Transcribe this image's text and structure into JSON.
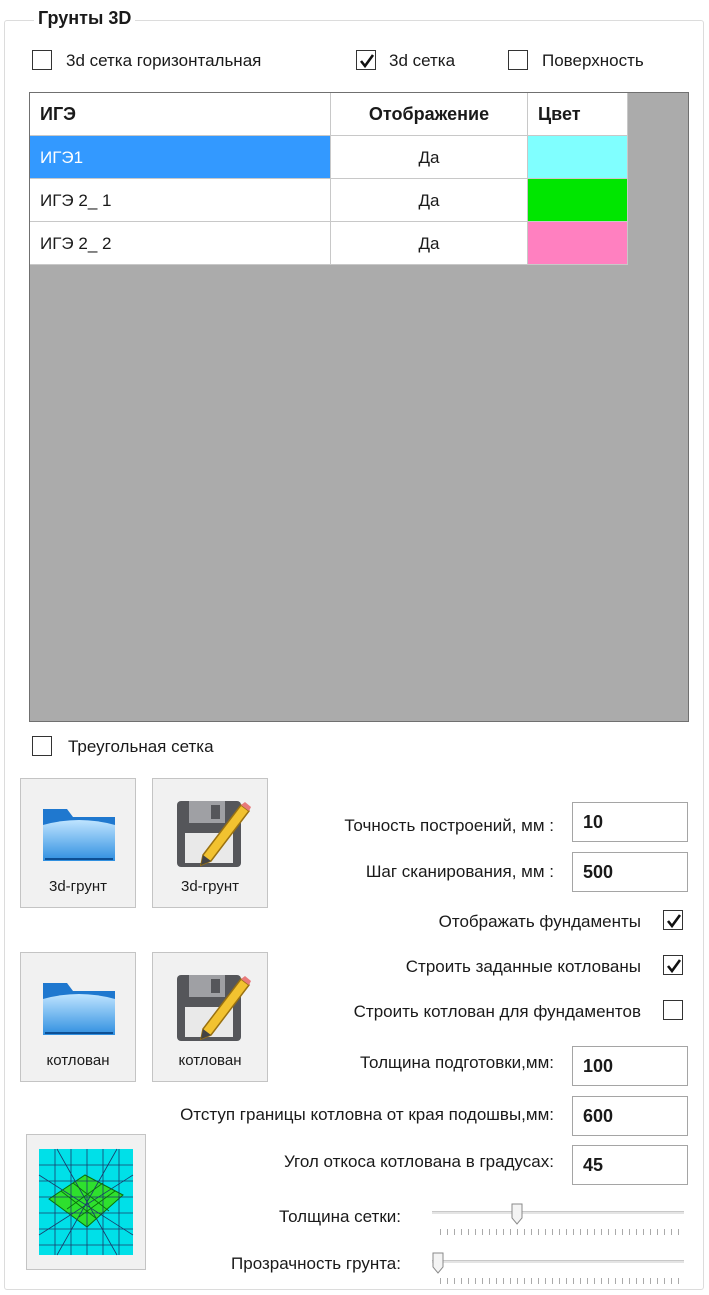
{
  "group": {
    "title": "Грунты 3D"
  },
  "top_options": {
    "grid_horizontal": {
      "label": "3d сетка горизонтальная",
      "checked": false
    },
    "grid_3d": {
      "label": "3d сетка",
      "checked": true
    },
    "surface": {
      "label": "Поверхность",
      "checked": false
    }
  },
  "table": {
    "columns": [
      "ИГЭ",
      "Отображение",
      "Цвет"
    ],
    "rows": [
      {
        "name": "ИГЭ1",
        "display": "Да",
        "color": "#80ffff",
        "selected": true
      },
      {
        "name": "ИГЭ 2_ 1",
        "display": "Да",
        "color": "#00e600",
        "selected": false
      },
      {
        "name": "ИГЭ 2_ 2",
        "display": "Да",
        "color": "#ff80c0",
        "selected": false
      }
    ]
  },
  "triangle_grid": {
    "label": "Треугольная сетка",
    "checked": false
  },
  "buttons": {
    "open_soil": {
      "label": "3d-грунт",
      "icon": "folder-icon"
    },
    "save_soil": {
      "label": "3d-грунт",
      "icon": "floppy-pencil-icon"
    },
    "open_pit": {
      "label": "котлован",
      "icon": "folder-icon"
    },
    "save_pit": {
      "label": "котлован",
      "icon": "floppy-pencil-icon"
    }
  },
  "fields": {
    "precision": {
      "label": "Точность построений, мм :",
      "value": "10"
    },
    "scan_step": {
      "label": "Шаг сканирования, мм :",
      "value": "500"
    },
    "prep_thickness": {
      "label": "Толщина подготовки,мм:",
      "value": "100"
    },
    "pit_offset": {
      "label": "Отступ границы котловна от края подошвы,мм:",
      "value": "600"
    },
    "slope_angle": {
      "label": "Угол откоса котлована в градусах:",
      "value": "45"
    }
  },
  "toggles": {
    "show_foundations": {
      "label": "Отображать фундаменты",
      "checked": true
    },
    "build_given_pits": {
      "label": "Строить заданные котлованы",
      "checked": true
    },
    "build_pit_for_foundations": {
      "label": "Строить котлован для фундаментов",
      "checked": false
    }
  },
  "sliders": {
    "grid_thickness": {
      "label": "Толщина сетки:",
      "level": 0.33
    },
    "soil_transparency": {
      "label": "Прозрачность грунта:",
      "level": 0.0
    }
  }
}
